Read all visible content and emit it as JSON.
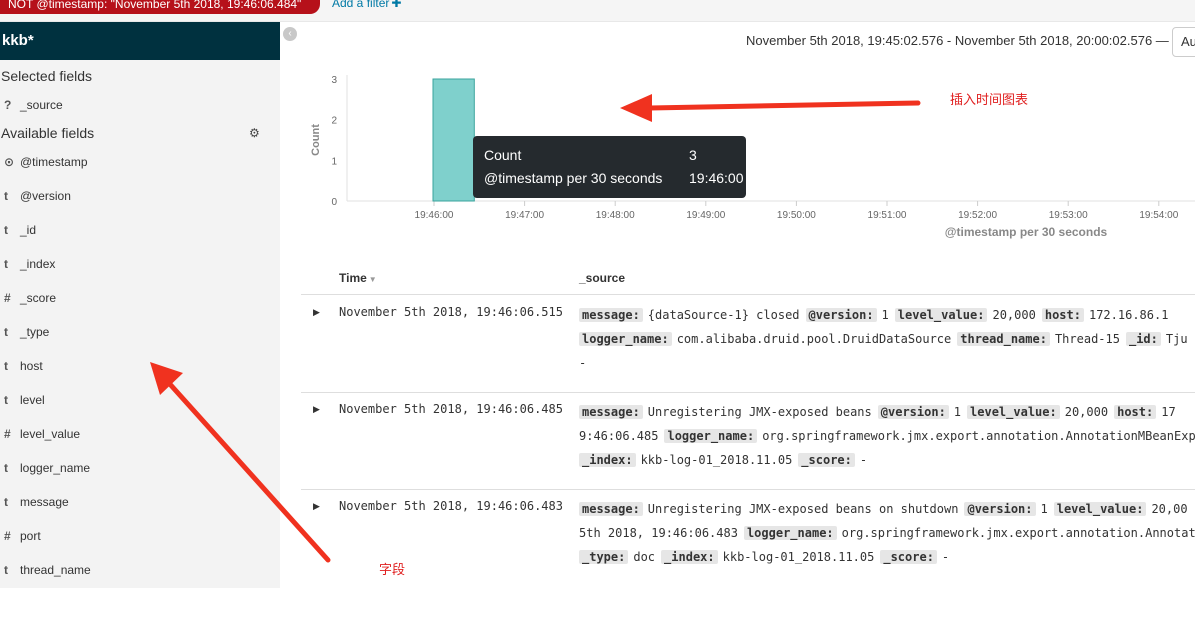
{
  "filter_bar": {
    "pill_text": "NOT @timestamp: \"November 5th 2018, 19:46:06.484\"",
    "add_filter_label": "Add a filter"
  },
  "sidebar": {
    "index_pattern": "kkb*",
    "selected_title": "Selected fields",
    "selected_fields": [
      {
        "type": "?",
        "name": "_source"
      }
    ],
    "available_title": "Available fields",
    "available_fields": [
      {
        "type": "clock",
        "name": "@timestamp"
      },
      {
        "type": "t",
        "name": "@version"
      },
      {
        "type": "t",
        "name": "_id"
      },
      {
        "type": "t",
        "name": "_index"
      },
      {
        "type": "#",
        "name": "_score"
      },
      {
        "type": "t",
        "name": "_type"
      },
      {
        "type": "t",
        "name": "host"
      },
      {
        "type": "t",
        "name": "level"
      },
      {
        "type": "#",
        "name": "level_value"
      },
      {
        "type": "t",
        "name": "logger_name"
      },
      {
        "type": "t",
        "name": "message"
      },
      {
        "type": "#",
        "name": "port"
      },
      {
        "type": "t",
        "name": "thread_name"
      }
    ]
  },
  "time_range": "November 5th 2018, 19:45:02.576 - November 5th 2018, 20:00:02.576 —",
  "interval_selector": "Au",
  "chart_data": {
    "type": "bar",
    "ylabel": "Count",
    "xlabel": "@timestamp per 30 seconds",
    "ylim": [
      0,
      3
    ],
    "yticks": [
      0,
      1,
      2,
      3
    ],
    "xticks": [
      "19:46:00",
      "19:47:00",
      "19:48:00",
      "19:49:00",
      "19:50:00",
      "19:51:00",
      "19:52:00",
      "19:53:00",
      "19:54:00"
    ],
    "bars": [
      {
        "x": "19:46:00",
        "value": 3
      }
    ],
    "bar_color": "#7fd0cc"
  },
  "tooltip": {
    "rows": [
      {
        "label": "Count",
        "value": "3"
      },
      {
        "label": "@timestamp per 30 seconds",
        "value": "19:46:00"
      }
    ]
  },
  "annotations": {
    "chart_note": "插入时间图表",
    "fields_note": "字段",
    "arrow_color": "#f0321f"
  },
  "table": {
    "col_time": "Time",
    "col_source": "_source",
    "rows": [
      {
        "time": "November 5th 2018, 19:46:06.515",
        "lines": [
          [
            [
              "message:",
              "{dataSource-1} closed"
            ],
            [
              "@version:",
              "1"
            ],
            [
              "level_value:",
              "20,000"
            ],
            [
              "host:",
              "172.16.86.1"
            ]
          ],
          [
            [
              "logger_name:",
              "com.alibaba.druid.pool.DruidDataSource"
            ],
            [
              "thread_name:",
              "Thread-15"
            ],
            [
              "_id:",
              "Tju"
            ]
          ],
          [
            [
              "",
              "-"
            ]
          ]
        ]
      },
      {
        "time": "November 5th 2018, 19:46:06.485",
        "lines": [
          [
            [
              "message:",
              "Unregistering JMX-exposed beans"
            ],
            [
              "@version:",
              "1"
            ],
            [
              "level_value:",
              "20,000"
            ],
            [
              "host:",
              "17"
            ]
          ],
          [
            [
              "",
              "9:46:06.485"
            ],
            [
              "logger_name:",
              "org.springframework.jmx.export.annotation.AnnotationMBeanExp"
            ]
          ],
          [
            [
              "_index:",
              "kkb-log-01_2018.11.05"
            ],
            [
              "_score:",
              "-"
            ]
          ]
        ]
      },
      {
        "time": "November 5th 2018, 19:46:06.483",
        "lines": [
          [
            [
              "message:",
              "Unregistering JMX-exposed beans on shutdown"
            ],
            [
              "@version:",
              "1"
            ],
            [
              "level_value:",
              "20,00"
            ]
          ],
          [
            [
              "",
              "5th 2018, 19:46:06.483"
            ],
            [
              "logger_name:",
              "org.springframework.jmx.export.annotation.Annotat"
            ]
          ],
          [
            [
              "_type:",
              "doc"
            ],
            [
              "_index:",
              "kkb-log-01_2018.11.05"
            ],
            [
              "_score:",
              "-"
            ]
          ]
        ]
      }
    ]
  }
}
